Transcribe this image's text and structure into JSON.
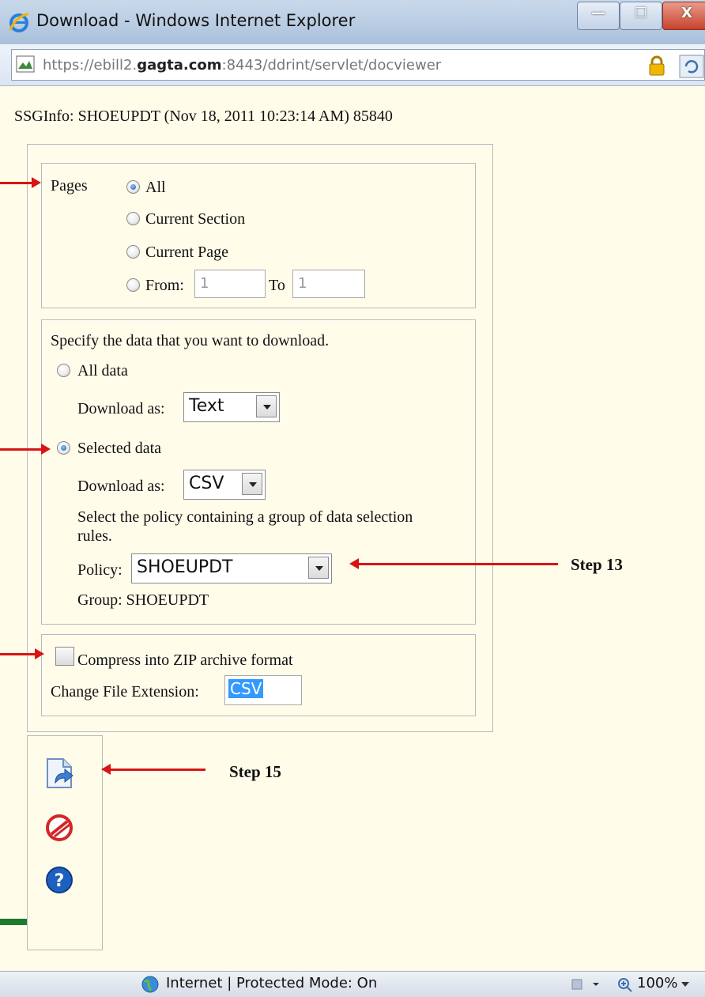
{
  "window": {
    "title": "Download - Windows Internet Explorer",
    "min_label": "—",
    "max_label": "☐",
    "close_label": "X"
  },
  "address": {
    "url_prefix": "https://ebill2.",
    "url_host": "gagta.com",
    "url_rest": ":8443/ddrint/servlet/docviewer"
  },
  "info_line": "SSGInfo:  SHOEUPDT (Nov 18, 2011 10:23:14 AM)  85840",
  "pages": {
    "label": "Pages",
    "options": [
      "All",
      "Current Section",
      "Current Page",
      "From:"
    ],
    "selected": "All",
    "from_value": "1",
    "to_label": "To",
    "to_value": "1"
  },
  "data_section": {
    "instruction": "Specify the data that you want to download.",
    "all_data_label": "All data",
    "download_as_label": "Download as:",
    "all_data_format": "Text",
    "selected_data_label": "Selected data",
    "selected_data_format": "CSV",
    "policy_instruction": "Select the policy containing a group of data selection rules.",
    "policy_label": "Policy:",
    "policy_value": "SHOEUPDT",
    "group_label": "Group: SHOEUPDT"
  },
  "compress": {
    "label": "Compress into ZIP archive format",
    "checked": false,
    "ext_label": "Change File Extension:",
    "ext_value": "CSV"
  },
  "annotations": {
    "step13": "Step 13",
    "step15": "Step 15",
    "arrow_color": "#d81414"
  },
  "toolbar_icons": [
    "download-icon",
    "cancel-icon",
    "help-icon"
  ],
  "status": {
    "zone_text": "Internet | Protected Mode: On",
    "zoom": "100%"
  }
}
